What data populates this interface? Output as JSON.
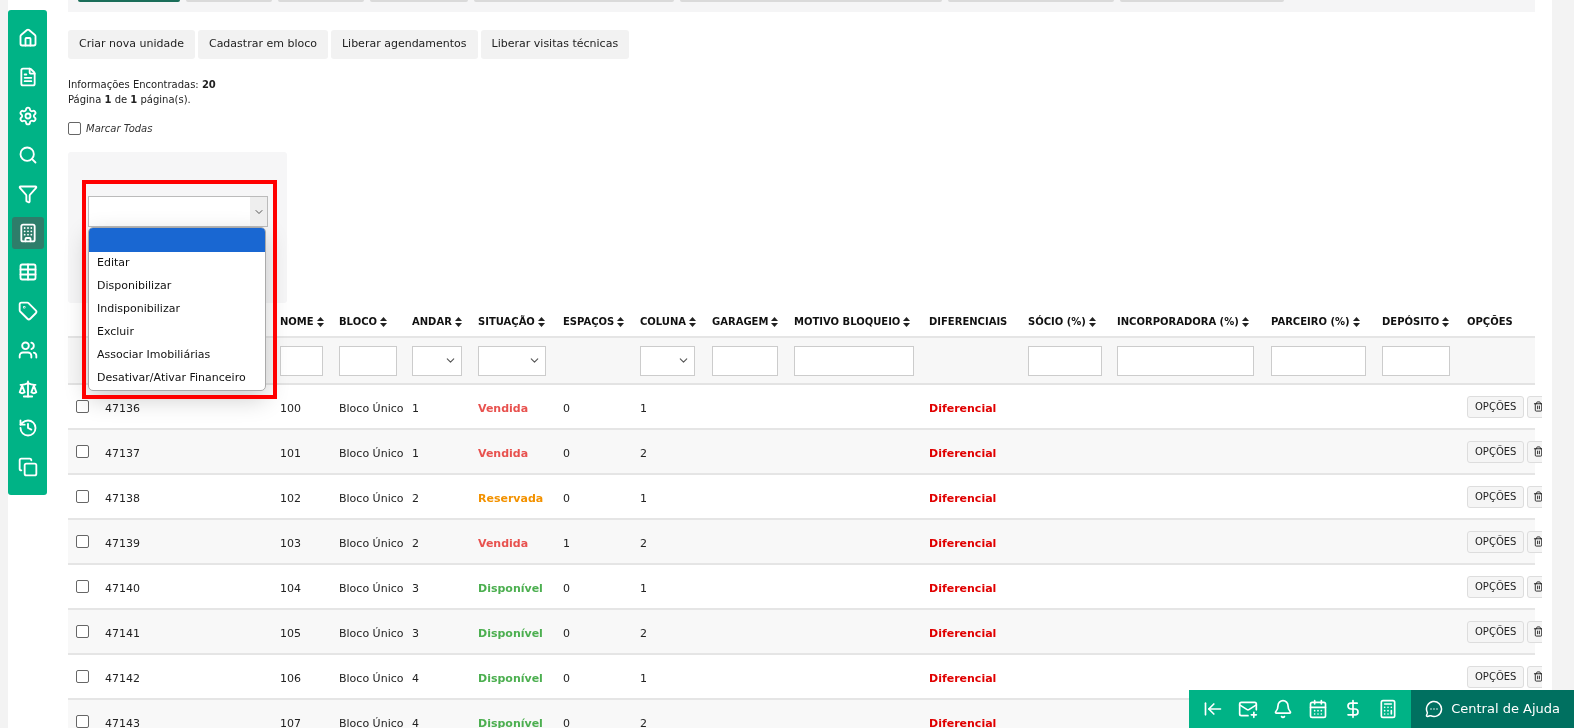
{
  "sidebar": {
    "items": [
      {
        "selected": false
      },
      {
        "selected": false
      },
      {
        "selected": false
      },
      {
        "selected": false
      },
      {
        "selected": false
      },
      {
        "selected": true
      },
      {
        "selected": false
      },
      {
        "selected": false
      },
      {
        "selected": false
      },
      {
        "selected": false
      },
      {
        "selected": false
      },
      {
        "selected": false
      }
    ]
  },
  "toolbar": {
    "buttons": [
      "Criar nova unidade",
      "Cadastrar em bloco",
      "Liberar agendamentos",
      "Liberar visitas técnicas"
    ]
  },
  "summary": {
    "found_label": "Informações Encontradas:",
    "found_count": "20",
    "page_text": "Página **1** de **1** página(s)."
  },
  "mark_all": {
    "label": "Marcar Todas",
    "checked": false
  },
  "action_select": {
    "expanded": true,
    "options": [
      {
        "label": "Editar",
        "selected": false
      },
      {
        "label": "Disponibilizar",
        "selected": false
      },
      {
        "label": "Indisponibilizar",
        "selected": false
      },
      {
        "label": "Excluir",
        "selected": false
      },
      {
        "label": "Associar Imobiliárias",
        "selected": false
      },
      {
        "label": "Desativar/Ativar Financeiro",
        "selected": false
      }
    ]
  },
  "table": {
    "columns": [
      {
        "kind": "check"
      },
      {
        "kind": "id"
      },
      {
        "kind": "text_filter",
        "label": "NOME",
        "sortable": true
      },
      {
        "kind": "text_filter",
        "label": "BLOCO",
        "sortable": true
      },
      {
        "kind": "select_filter",
        "label": "ANDAR",
        "sortable": true
      },
      {
        "kind": "select_filter",
        "label": "SITUAÇÃO",
        "sortable": true
      },
      {
        "kind": "plain",
        "label": "ESPAÇOS",
        "sortable": true
      },
      {
        "kind": "select_filter",
        "label": "COLUNA",
        "sortable": true
      },
      {
        "kind": "text_filter",
        "label": "GARAGEM",
        "sortable": true
      },
      {
        "kind": "text_filter",
        "label": "MOTIVO BLOQUEIO",
        "sortable": true
      },
      {
        "kind": "plain",
        "label": "DIFERENCIAIS",
        "sortable": false
      },
      {
        "kind": "text_filter",
        "label": "SÓCIO (%)",
        "sortable": true
      },
      {
        "kind": "text_filter",
        "label": "INCORPORADORA (%)",
        "sortable": true
      },
      {
        "kind": "text_filter",
        "label": "PARCEIRO (%)",
        "sortable": true
      },
      {
        "kind": "text_filter",
        "label": "DEPÓSITO",
        "sortable": true
      },
      {
        "kind": "plain",
        "label": "OPÇÕES",
        "sortable": false
      }
    ],
    "rows": [
      {
        "checked": false,
        "id": "47136",
        "nome": "100",
        "bloco": "Bloco Único",
        "andar": "1",
        "situacao": "Vendida",
        "color": "#e8524f",
        "espacos": "0",
        "coluna": "1",
        "diferenciais": "Diferencial",
        "options_button": "OPÇÕES"
      },
      {
        "checked": false,
        "id": "47137",
        "nome": "101",
        "bloco": "Bloco Único",
        "andar": "1",
        "situacao": "Vendida",
        "color": "#e8524f",
        "espacos": "0",
        "coluna": "2",
        "diferenciais": "Diferencial",
        "options_button": "OPÇÕES"
      },
      {
        "checked": false,
        "id": "47138",
        "nome": "102",
        "bloco": "Bloco Único",
        "andar": "2",
        "situacao": "Reservada",
        "color": "#f39200",
        "espacos": "0",
        "coluna": "1",
        "diferenciais": "Diferencial",
        "options_button": "OPÇÕES"
      },
      {
        "checked": false,
        "id": "47139",
        "nome": "103",
        "bloco": "Bloco Único",
        "andar": "2",
        "situacao": "Vendida",
        "color": "#e8524f",
        "espacos": "1",
        "coluna": "2",
        "diferenciais": "Diferencial",
        "options_button": "OPÇÕES"
      },
      {
        "checked": false,
        "id": "47140",
        "nome": "104",
        "bloco": "Bloco Único",
        "andar": "3",
        "situacao": "Disponível",
        "color": "#4caf50",
        "espacos": "0",
        "coluna": "1",
        "diferenciais": "Diferencial",
        "options_button": "OPÇÕES"
      },
      {
        "checked": false,
        "id": "47141",
        "nome": "105",
        "bloco": "Bloco Único",
        "andar": "3",
        "situacao": "Disponível",
        "color": "#4caf50",
        "espacos": "0",
        "coluna": "2",
        "diferenciais": "Diferencial",
        "options_button": "OPÇÕES"
      },
      {
        "checked": false,
        "id": "47142",
        "nome": "106",
        "bloco": "Bloco Único",
        "andar": "4",
        "situacao": "Disponível",
        "color": "#4caf50",
        "espacos": "0",
        "coluna": "1",
        "diferenciais": "Diferencial",
        "options_button": "OPÇÕES"
      },
      {
        "checked": false,
        "id": "47143",
        "nome": "107",
        "bloco": "Bloco Único",
        "andar": "4",
        "situacao": "Disponível",
        "color": "#4caf50",
        "espacos": "0",
        "coluna": "2",
        "diferenciais": "Diferencial"
      }
    ]
  },
  "bottom_bar": {
    "help_label": "Central de Ajuda"
  }
}
